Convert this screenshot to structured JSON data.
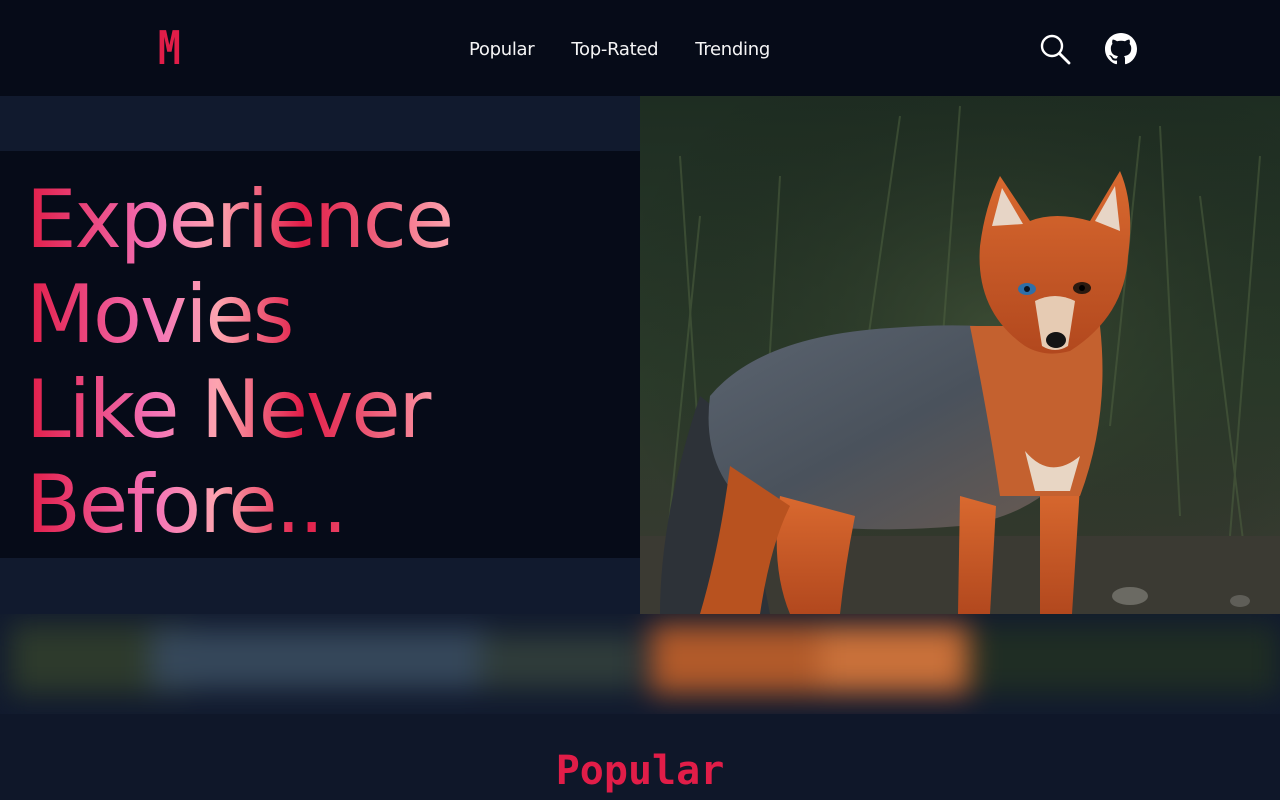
{
  "header": {
    "logo": "M",
    "nav": [
      {
        "label": "Popular"
      },
      {
        "label": "Top-Rated"
      },
      {
        "label": "Trending"
      }
    ],
    "icons": {
      "search": "search-icon",
      "github": "github-icon"
    }
  },
  "hero": {
    "headline_lines": [
      "Experience",
      "Movies",
      "Like Never",
      "Before..."
    ],
    "image_subject": "fox-photo"
  },
  "sections": {
    "popular_title": "Popular"
  },
  "colors": {
    "accent": "#e11d48",
    "accent_light": "#fda4af",
    "nav_bg": "#060b18",
    "page_bg": "#0f1729"
  }
}
